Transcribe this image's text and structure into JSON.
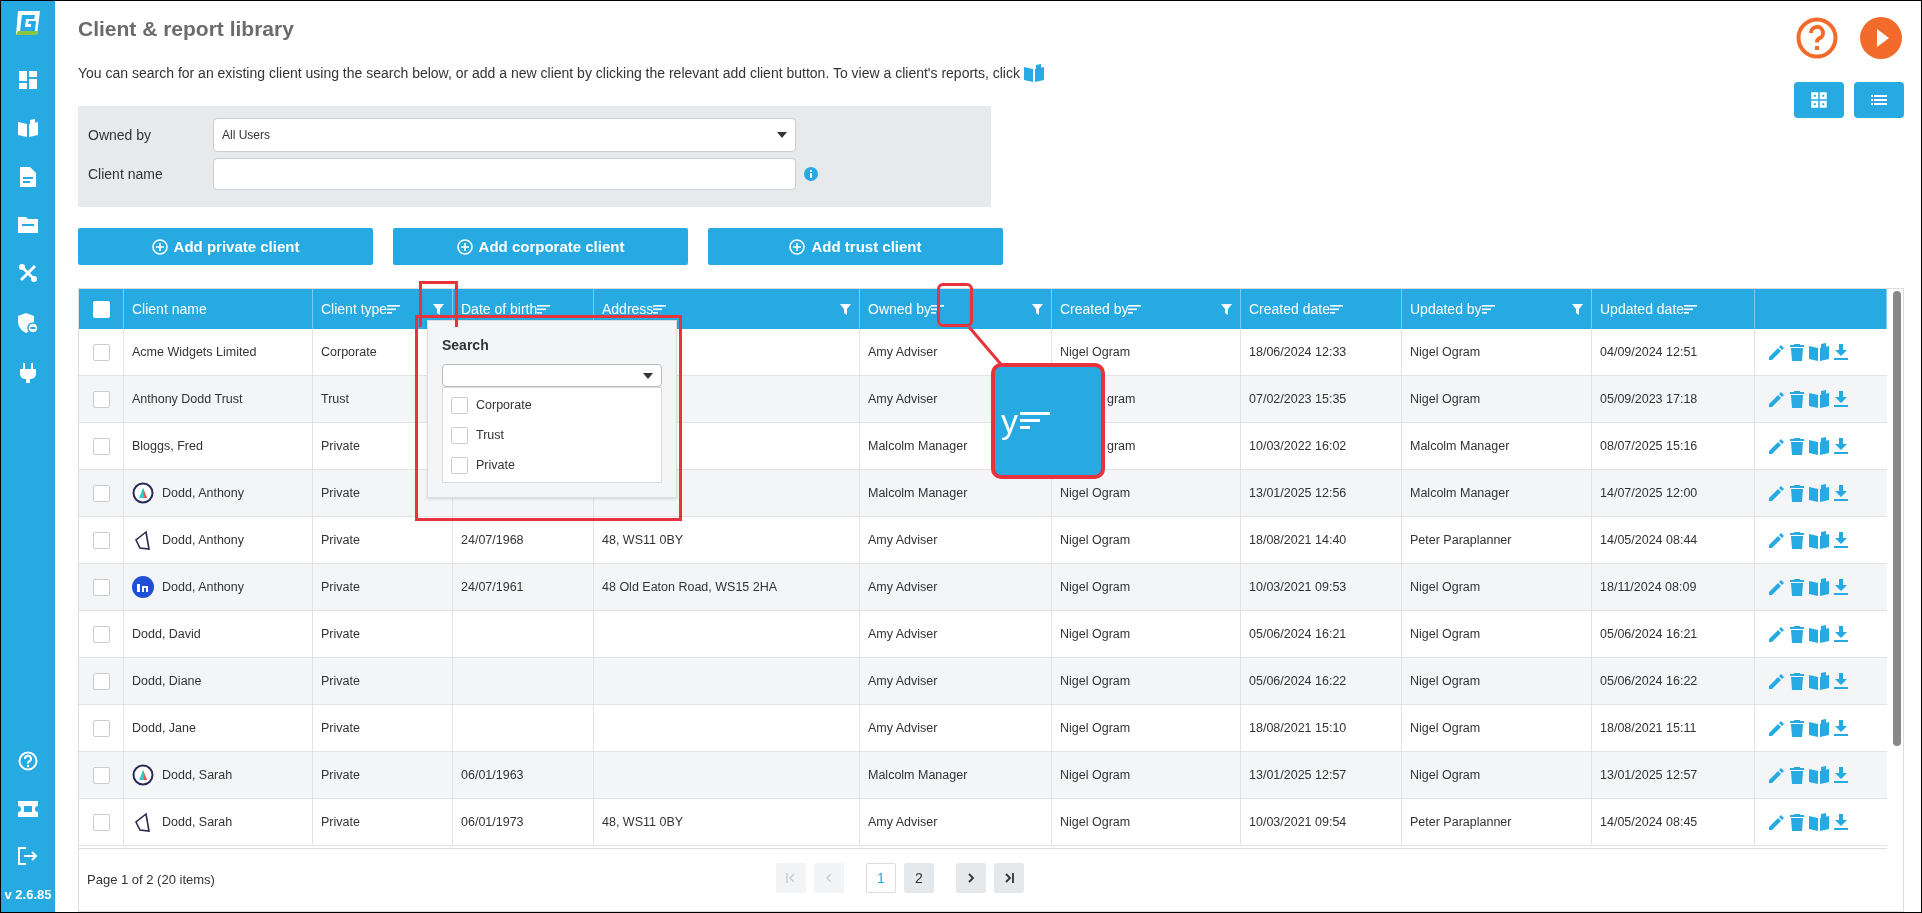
{
  "sidebar": {
    "version": "v 2.6.85"
  },
  "page": {
    "title": "Client & report library",
    "description": "You can search for an existing client using the search below, or add a new client by clicking the relevant add client button. To view a client's reports, click"
  },
  "filters": {
    "owned_by_label": "Owned by",
    "owned_by_value": "All Users",
    "client_name_label": "Client name"
  },
  "add_buttons": [
    "Add private client",
    "Add corporate client",
    "Add trust client"
  ],
  "table": {
    "columns": [
      {
        "kind": "check",
        "checked": false
      },
      {
        "kind": "text",
        "label": "Client name",
        "sort": false,
        "filter": false
      },
      {
        "kind": "text",
        "label": "Client type",
        "sort": true,
        "filter": true
      },
      {
        "kind": "text",
        "label": "Date of birth",
        "sort": true,
        "filter": false
      },
      {
        "kind": "text",
        "label": "Address",
        "sort": true,
        "filter": true
      },
      {
        "kind": "text",
        "label": "Owned by",
        "sort": true,
        "filter": true
      },
      {
        "kind": "text",
        "label": "Created by",
        "sort": true,
        "filter": true
      },
      {
        "kind": "text",
        "label": "Created date",
        "sort": true,
        "filter": false
      },
      {
        "kind": "text",
        "label": "Updated by",
        "sort": true,
        "filter": true
      },
      {
        "kind": "text",
        "label": "Updated date",
        "sort": true,
        "filter": false
      },
      {
        "kind": "actions"
      }
    ],
    "rows": [
      {
        "checked": false,
        "name": "Acme Widgets Limited",
        "type": "Corporate",
        "owned_by": "Amy Adviser",
        "created_by": "Nigel Ogram",
        "created_date": "18/06/2024 12:33",
        "updated_by": "Nigel Ogram",
        "updated_date": "04/09/2024 12:51"
      },
      {
        "checked": false,
        "name": "Anthony Dodd Trust",
        "type": "Trust",
        "owned_by": "Amy Adviser",
        "created_by": "gram",
        "created_by_cut": true,
        "created_date": "07/02/2023 15:35",
        "updated_by": "Nigel Ogram",
        "updated_date": "05/09/2023 17:18"
      },
      {
        "checked": false,
        "name": "Bloggs, Fred",
        "type": "Private",
        "owned_by": "Malcolm Manager",
        "created_by": "gram",
        "created_by_cut": true,
        "created_date": "10/03/2022 16:02",
        "updated_by": "Malcolm Manager",
        "updated_date": "08/07/2025 15:16"
      },
      {
        "checked": false,
        "avatar": {
          "kind": "ring"
        },
        "name": "Dodd, Anthony",
        "type": "Private",
        "owned_by": "Malcolm Manager",
        "created_by": "Nigel Ogram",
        "created_date": "13/01/2025 12:56",
        "updated_by": "Malcolm Manager",
        "updated_date": "14/07/2025 12:00"
      },
      {
        "checked": false,
        "avatar": {
          "kind": "kite"
        },
        "name": "Dodd, Anthony",
        "type": "Private",
        "dob": "24/07/1968",
        "address": "48, WS11 0BY",
        "owned_by": "Amy Adviser",
        "created_by": "Nigel Ogram",
        "created_date": "18/08/2021 14:40",
        "updated_by": "Peter Paraplanner",
        "updated_date": "14/05/2024 08:44"
      },
      {
        "checked": false,
        "avatar": {
          "kind": "disc"
        },
        "name": "Dodd, Anthony",
        "type": "Private",
        "dob": "24/07/1961",
        "address": "48 Old Eaton Road, WS15 2HA",
        "owned_by": "Amy Adviser",
        "created_by": "Nigel Ogram",
        "created_date": "10/03/2021 09:53",
        "updated_by": "Nigel Ogram",
        "updated_date": "18/11/2024 08:09"
      },
      {
        "checked": false,
        "name": "Dodd, David",
        "type": "Private",
        "owned_by": "Amy Adviser",
        "created_by": "Nigel Ogram",
        "created_date": "05/06/2024 16:21",
        "updated_by": "Nigel Ogram",
        "updated_date": "05/06/2024 16:21"
      },
      {
        "checked": false,
        "name": "Dodd, Diane",
        "type": "Private",
        "owned_by": "Amy Adviser",
        "created_by": "Nigel Ogram",
        "created_date": "05/06/2024 16:22",
        "updated_by": "Nigel Ogram",
        "updated_date": "05/06/2024 16:22"
      },
      {
        "checked": false,
        "name": "Dodd, Jane",
        "type": "Private",
        "owned_by": "Amy Adviser",
        "created_by": "Nigel Ogram",
        "created_date": "18/08/2021 15:10",
        "updated_by": "Nigel Ogram",
        "updated_date": "18/08/2021 15:11"
      },
      {
        "checked": false,
        "avatar": {
          "kind": "ring"
        },
        "name": "Dodd, Sarah",
        "type": "Private",
        "dob": "06/01/1963",
        "owned_by": "Malcolm Manager",
        "created_by": "Nigel Ogram",
        "created_date": "13/01/2025 12:57",
        "updated_by": "Nigel Ogram",
        "updated_date": "13/01/2025 12:57"
      },
      {
        "checked": false,
        "avatar": {
          "kind": "kite"
        },
        "name": "Dodd, Sarah",
        "type": "Private",
        "dob": "06/01/1973",
        "address": "48, WS11 0BY",
        "owned_by": "Amy Adviser",
        "created_by": "Nigel Ogram",
        "created_date": "10/03/2021 09:54",
        "updated_by": "Peter Paraplanner",
        "updated_date": "14/05/2024 08:45"
      }
    ]
  },
  "filter_popup": {
    "title": "Search",
    "options": [
      {
        "label": "Corporate",
        "checked": false
      },
      {
        "label": "Trust",
        "checked": false
      },
      {
        "label": "Private",
        "checked": false
      }
    ]
  },
  "callout": {
    "text": "y"
  },
  "pagination": {
    "summary": "Page 1 of 2 (20 items)",
    "pages": [
      {
        "label": "1",
        "selected": true
      },
      {
        "label": "2",
        "selected": false
      }
    ],
    "first_disabled": true,
    "prev_disabled": true,
    "next_disabled": false,
    "last_disabled": false
  }
}
